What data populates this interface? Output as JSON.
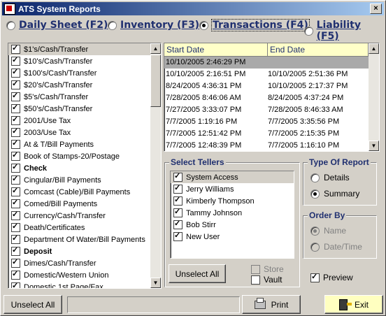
{
  "window": {
    "title": "ATS System Reports",
    "close_glyph": "×"
  },
  "report_types": [
    {
      "label": "Daily Sheet (F2)",
      "selected": false
    },
    {
      "label": "Inventory (F3)",
      "selected": false
    },
    {
      "label": "Transactions (F4)",
      "selected": true
    },
    {
      "label": "Liability (F5)",
      "selected": false
    }
  ],
  "transaction_types": [
    {
      "label": "$1's/Cash/Transfer",
      "checked": true,
      "bold": false
    },
    {
      "label": "$10's/Cash/Transfer",
      "checked": true,
      "bold": false
    },
    {
      "label": "$100's/Cash/Transfer",
      "checked": true,
      "bold": false
    },
    {
      "label": "$20's/Cash/Transfer",
      "checked": true,
      "bold": false
    },
    {
      "label": "$5's/Cash/Transfer",
      "checked": true,
      "bold": false
    },
    {
      "label": "$50's/Cash/Transfer",
      "checked": true,
      "bold": false
    },
    {
      "label": "2001/Use Tax",
      "checked": true,
      "bold": false
    },
    {
      "label": "2003/Use Tax",
      "checked": true,
      "bold": false
    },
    {
      "label": "At & T/Bill Payments",
      "checked": true,
      "bold": false
    },
    {
      "label": "Book of Stamps-20/Postage",
      "checked": true,
      "bold": false
    },
    {
      "label": "Check",
      "checked": true,
      "bold": true
    },
    {
      "label": "Cingular/Bill Payments",
      "checked": true,
      "bold": false
    },
    {
      "label": "Comcast (Cable)/Bill Payments",
      "checked": true,
      "bold": false
    },
    {
      "label": "Comed/Bill Payments",
      "checked": true,
      "bold": false
    },
    {
      "label": "Currency/Cash/Transfer",
      "checked": true,
      "bold": false
    },
    {
      "label": "Death/Certificates",
      "checked": true,
      "bold": false
    },
    {
      "label": "Department Of Water/Bill Payments",
      "checked": true,
      "bold": false
    },
    {
      "label": "Deposit",
      "checked": true,
      "bold": true
    },
    {
      "label": "Dimes/Cash/Transfer",
      "checked": true,
      "bold": false
    },
    {
      "label": "Domestic/Western Union",
      "checked": true,
      "bold": false
    },
    {
      "label": "Domestic 1st Page/Fax",
      "checked": true,
      "bold": false
    }
  ],
  "sessions": {
    "headers": [
      "Start Date",
      "End Date"
    ],
    "rows": [
      [
        "10/10/2005 2:46:29 PM",
        ""
      ],
      [
        "10/10/2005 2:16:51 PM",
        "10/10/2005 2:51:36 PM"
      ],
      [
        "8/24/2005 4:36:31 PM",
        "10/10/2005 2:17:37 PM"
      ],
      [
        "7/28/2005 8:46:06 AM",
        "8/24/2005 4:37:24 PM"
      ],
      [
        "7/27/2005 3:33:07 PM",
        "7/28/2005 8:46:33 AM"
      ],
      [
        "7/7/2005 1:19:16 PM",
        "7/7/2005 3:35:56 PM"
      ],
      [
        "7/7/2005 12:51:42 PM",
        "7/7/2005 2:15:35 PM"
      ],
      [
        "7/7/2005 12:48:39 PM",
        "7/7/2005 1:16:10 PM"
      ]
    ]
  },
  "tellers": {
    "title": "Select Tellers",
    "items": [
      {
        "label": "System Access",
        "checked": true
      },
      {
        "label": "Jerry Williams",
        "checked": true
      },
      {
        "label": "Kimberly Thompson",
        "checked": true
      },
      {
        "label": "Tammy Johnson",
        "checked": true
      },
      {
        "label": "Bob Stirr",
        "checked": true
      },
      {
        "label": "New User",
        "checked": true
      }
    ],
    "unselect_all": "Unselect All"
  },
  "location": {
    "store": "Store",
    "vault": "Vault"
  },
  "type_of_report": {
    "title": "Type Of Report",
    "details": "Details",
    "summary": "Summary",
    "selected": "summary"
  },
  "order_by": {
    "title": "Order By",
    "name": "Name",
    "datetime": "Date/Time",
    "selected": "name"
  },
  "preview": {
    "label": "Preview",
    "checked": true
  },
  "bottom": {
    "unselect_all": "Unselect All",
    "print": "Print",
    "exit": "Exit",
    "status": ""
  }
}
